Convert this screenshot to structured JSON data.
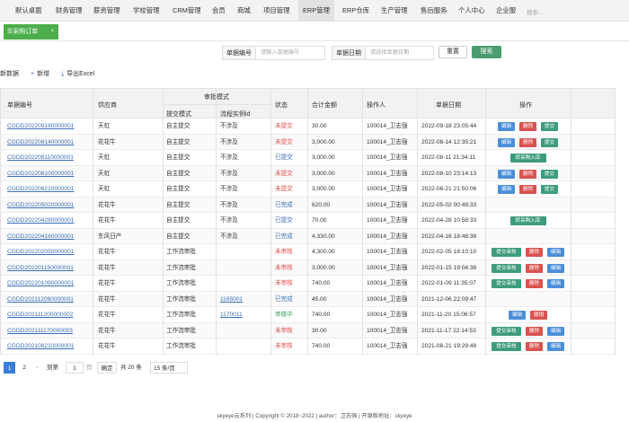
{
  "nav": {
    "items": [
      "默认桌面",
      "财务管理",
      "薪资管理",
      "学校管理",
      "CRM管理",
      "会员",
      "商城",
      "项目管理",
      "ERP管理",
      "ERP仓库",
      "生产管理",
      "售后服务",
      "个人中心",
      "企业服"
    ],
    "active_index": 8,
    "search_placeholder": "搜索..."
  },
  "tab": {
    "label": "采购订单",
    "menu_icon": "☰",
    "close_icon": "×"
  },
  "filters": {
    "order_no_label": "单据编号",
    "order_no_placeholder": "请输入单据编号",
    "date_label": "单据日期",
    "date_placeholder": "请选择单据日期",
    "reset_label": "重置",
    "search_label": "搜索"
  },
  "toolbar": {
    "refresh_label": "新数据",
    "add_label": "新增",
    "export_label": "导出Excel"
  },
  "table": {
    "headers": {
      "code": "单据编号",
      "supplier": "供应商",
      "approval_group": "审批模式",
      "submit_mode": "提交模式",
      "flow_id": "流程实例id",
      "status": "状态",
      "amount": "合计金额",
      "operator": "操作人",
      "date": "单据日期",
      "actions": "操作"
    },
    "rows": [
      {
        "code": "CGDD202209180000001",
        "supplier": "天虹",
        "mode": "自主提交",
        "flow": "不涉及",
        "status": "未提交",
        "status_color": "#d9534f",
        "amount": "30.00",
        "operator": "100014_卫志强",
        "date": "2022-09-18 23:05:44",
        "actions": [
          "编辑",
          "删除",
          "提交"
        ]
      },
      {
        "code": "CGDD202208140000001",
        "supplier": "花花牛",
        "mode": "自主提交",
        "flow": "不涉及",
        "status": "未提交",
        "status_color": "#d9534f",
        "amount": "3,000.00",
        "operator": "100014_卫志强",
        "date": "2022-08-14 12:35:21",
        "actions": [
          "编辑",
          "删除",
          "提交"
        ]
      },
      {
        "code": "CGDD202208110000001",
        "supplier": "天虹",
        "mode": "自主提交",
        "flow": "不涉及",
        "status": "已提交",
        "status_color": "#3b6fb6",
        "amount": "3,000.00",
        "operator": "100014_卫志强",
        "date": "2022-08-11 21:34:11",
        "actions": [
          "转采购入库"
        ]
      },
      {
        "code": "CGDD202208100000001",
        "supplier": "天虹",
        "mode": "自主提交",
        "flow": "不涉及",
        "status": "未提交",
        "status_color": "#d9534f",
        "amount": "3,000.00",
        "operator": "100014_卫志强",
        "date": "2022-08-10 23:14:13",
        "actions": [
          "编辑",
          "删除",
          "提交"
        ]
      },
      {
        "code": "CGDD202206210000001",
        "supplier": "天虹",
        "mode": "自主提交",
        "flow": "不涉及",
        "status": "未提交",
        "status_color": "#d9534f",
        "amount": "3,000.00",
        "operator": "100014_卫志强",
        "date": "2022-06-21 21:50:06",
        "actions": [
          "编辑",
          "删除",
          "提交"
        ]
      },
      {
        "code": "CGDD202205020000001",
        "supplier": "花花牛",
        "mode": "自主提交",
        "flow": "不涉及",
        "status": "已完成",
        "status_color": "#3b6fb6",
        "amount": "620.00",
        "operator": "100014_卫志强",
        "date": "2022-05-02 00:49:33",
        "actions": []
      },
      {
        "code": "CGDD202204280000001",
        "supplier": "花花牛",
        "mode": "自主提交",
        "flow": "不涉及",
        "status": "已提交",
        "status_color": "#3b6fb6",
        "amount": "70.00",
        "operator": "100014_卫志强",
        "date": "2022-04-28 10:58:33",
        "actions": [
          "转采购入库"
        ]
      },
      {
        "code": "CGDD202204160000001",
        "supplier": "东风日产",
        "mode": "自主提交",
        "flow": "不涉及",
        "status": "已完成",
        "status_color": "#3b6fb6",
        "amount": "4,330.00",
        "operator": "100014_卫志强",
        "date": "2022-04-16 18:48:38",
        "actions": []
      },
      {
        "code": "CGDD202202050000001",
        "supplier": "花花牛",
        "mode": "工作流审批",
        "flow": "",
        "status": "未审核",
        "status_color": "#d9534f",
        "amount": "4,300.00",
        "operator": "100014_卫志强",
        "date": "2022-02-05 18:10:10",
        "actions": [
          "提交审核",
          "删除",
          "编辑"
        ]
      },
      {
        "code": "CGDD202201150000001",
        "supplier": "花花牛",
        "mode": "工作流审批",
        "flow": "",
        "status": "未审核",
        "status_color": "#d9534f",
        "amount": "3,000.00",
        "operator": "100014_卫志强",
        "date": "2022-01-15 19:04:38",
        "actions": [
          "提交审核",
          "删除",
          "编辑"
        ]
      },
      {
        "code": "CGDD202201090000001",
        "supplier": "花花牛",
        "mode": "工作流审批",
        "flow": "",
        "status": "未审核",
        "status_color": "#d9534f",
        "amount": "740.00",
        "operator": "100014_卫志强",
        "date": "2022-01-09 11:35:07",
        "actions": [
          "提交审核",
          "删除",
          "编辑"
        ]
      },
      {
        "code": "CGDD202112060000001",
        "supplier": "花花牛",
        "mode": "工作流审批",
        "flow": "1165001",
        "status": "已完成",
        "status_color": "#3b6fb6",
        "amount": "45.00",
        "operator": "100014_卫志强",
        "date": "2021-12-06 22:09:47",
        "actions": []
      },
      {
        "code": "CGDD202111200000002",
        "supplier": "花花牛",
        "mode": "工作流审批",
        "flow": "1170011",
        "status": "审核中",
        "status_color": "#3e9c5e",
        "amount": "740.00",
        "operator": "100014_卫志强",
        "date": "2021-11-20 15:06:57",
        "actions": [
          "编辑",
          "撤销"
        ]
      },
      {
        "code": "CGDD202111170000003",
        "supplier": "花花牛",
        "mode": "工作流审批",
        "flow": "",
        "status": "未审核",
        "status_color": "#d9534f",
        "amount": "30.00",
        "operator": "100014_卫志强",
        "date": "2021-11-17 22:14:53",
        "actions": [
          "提交审核",
          "删除",
          "编辑"
        ]
      },
      {
        "code": "CGDD202108210000001",
        "supplier": "花花牛",
        "mode": "工作流审批",
        "flow": "",
        "status": "未审核",
        "status_color": "#d9534f",
        "amount": "740.00",
        "operator": "100014_卫志强",
        "date": "2021-08-21 19:29:48",
        "actions": [
          "提交审核",
          "删除",
          "编辑"
        ]
      }
    ]
  },
  "pager": {
    "page1": "1",
    "page2": "2",
    "prev_icon": "‹",
    "next_icon": "›",
    "goto_label": "到第",
    "goto_value": "1",
    "page_unit": "页",
    "confirm_label": "确定",
    "total_label": "共 20 条",
    "page_size": "15 条/页"
  },
  "footer": {
    "text": "skyeye云系列 | Copyright © 2018~2022 | author：卫志强 | 开源版地址：skyeye"
  }
}
